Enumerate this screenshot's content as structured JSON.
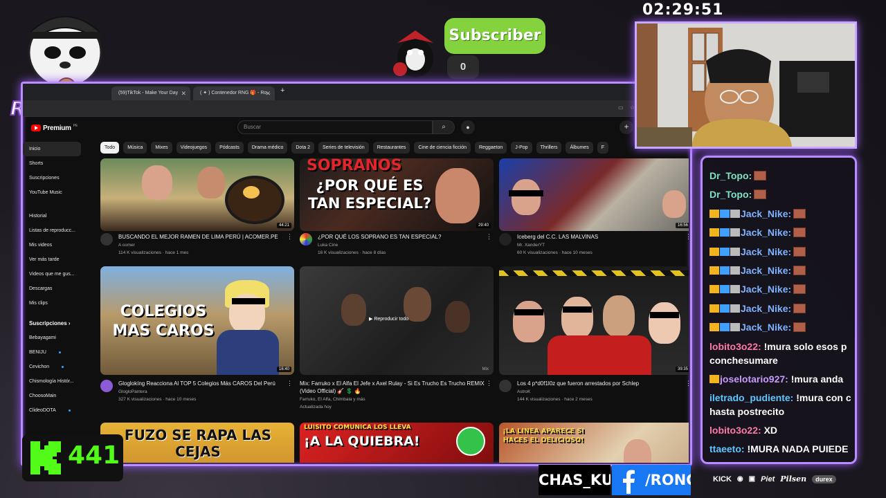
{
  "timer": "02:29:51",
  "subscriber": {
    "label": "Subscriber",
    "count": "0"
  },
  "streamer_name": "RONCHAS",
  "kick": {
    "count": "441"
  },
  "social": {
    "handle_left": "CHAS_KUN",
    "handle_right": "/RONC",
    "sponsors": [
      "KICK",
      "Piet",
      "Pilsen",
      "durex"
    ]
  },
  "browser": {
    "tabs": [
      {
        "title": "(59)TikTok - Make Your Day"
      },
      {
        "title": "( ✦ ) Contenedor RNG 🎁 - Ro..."
      }
    ]
  },
  "youtube": {
    "brand": "Premium",
    "region": "PE",
    "search_placeholder": "Buscar",
    "sidebar": {
      "main": [
        "Inicio",
        "Shorts",
        "Suscripciones",
        "YouTube Music"
      ],
      "you": [
        "Historial",
        "Listas de reproducc...",
        "Mis videos",
        "Ver más tarde",
        "Videos que me gus...",
        "Descargas",
        "Mis clips"
      ],
      "subs_header": "Suscripciones",
      "subs": [
        "Bebayagami",
        "BENIJU",
        "Cevichon",
        "Chismología Histór...",
        "ChoosoMain",
        "ClideoDOTA"
      ]
    },
    "chips": [
      "Todo",
      "Música",
      "Mixes",
      "Videojuegos",
      "Pódcasts",
      "Drama médico",
      "Dota 2",
      "Series de televisión",
      "Restaurantes",
      "Cine de ciencia ficción",
      "Reggaeton",
      "J-Pop",
      "Thrillers",
      "Álbumes",
      "F"
    ],
    "videos": [
      {
        "title": "BUSCANDO EL MEJOR RAMEN DE LIMA PERÚ | ACOMER.PE",
        "channel": "A comer",
        "stats": "114 K visualizaciones · hace 1 mes",
        "duration": "44:21",
        "thumb_text": ""
      },
      {
        "title": "¿POR QUÉ LOS SOPRANO ES TAN ESPECIAL?",
        "channel": "Luka Cine",
        "stats": "16 K visualizaciones · hace 8 días",
        "duration": "29:40",
        "thumb_text": "¿POR QUÉ ES TAN ESPECIAL?",
        "thumb_text_top": "SOPRANOS"
      },
      {
        "title": "Iceberg del C.C. LAS MALVINAS",
        "channel": "Mr. XanderYT",
        "stats": "60 K visualizaciones · hace 10 meses",
        "duration": "16:56",
        "thumb_text": ""
      },
      {
        "title": "Gloglokíng Reacciona Al TOP 5 Colegios Más CAROS Del Perú",
        "channel": "GlogloPantera",
        "stats": "327 K visualizaciones · hace 10 meses",
        "duration": "16:40",
        "thumb_text": "COLEGIOS MAS CAROS"
      },
      {
        "title": "Mix: Farruko x El Alfa El Jefe x Axel Rulay - Si Es Trucho Es Trucho REMIX (Video Official) 🎸 💲 🔥",
        "channel": "Farruko, El Alfa, Chimbala y más",
        "stats": "Actualizada hoy",
        "duration": "Mix",
        "thumb_text": "Reproducir todo"
      },
      {
        "title": "Los 4 p*d0f1l0z que fueron arrestados por Schlep",
        "channel": "AstroK",
        "stats": "144 K visualizaciones · hace 2 meses",
        "duration": "39:35",
        "thumb_text": ""
      },
      {
        "title": "",
        "channel": "",
        "stats": "",
        "duration": "",
        "thumb_text": "FUZO SE RAPA LAS CEJAS"
      },
      {
        "title": "",
        "channel": "",
        "stats": "",
        "duration": "",
        "thumb_text": "¡A LA QUIEBRA!",
        "thumb_text_top": "LUISITO COMUNICA LOS LLEVA"
      },
      {
        "title": "",
        "channel": "",
        "stats": "",
        "duration": "",
        "thumb_text": "¡LA LINEA APARECE SI HACES EL DELICIOSO!"
      }
    ]
  },
  "chat": [
    {
      "user": "Dr_Topo:",
      "msg": "",
      "color": "#7fe3c8",
      "emote": true
    },
    {
      "user": "Dr_Topo:",
      "msg": "",
      "color": "#7fe3c8",
      "emote": true
    },
    {
      "user": "Jack_Nike:",
      "msg": "",
      "color": "#7fb2ff",
      "emote": true,
      "badges": true
    },
    {
      "user": "Jack_Nike:",
      "msg": "",
      "color": "#7fb2ff",
      "emote": true,
      "badges": true
    },
    {
      "user": "Jack_Nike:",
      "msg": "",
      "color": "#7fb2ff",
      "emote": true,
      "badges": true
    },
    {
      "user": "Jack_Nike:",
      "msg": "",
      "color": "#7fb2ff",
      "emote": true,
      "badges": true
    },
    {
      "user": "Jack_Nike:",
      "msg": "",
      "color": "#7fb2ff",
      "emote": true,
      "badges": true
    },
    {
      "user": "Jack_Nike:",
      "msg": "",
      "color": "#7fb2ff",
      "emote": true,
      "badges": true
    },
    {
      "user": "Jack_Nike:",
      "msg": "",
      "color": "#7fb2ff",
      "emote": true,
      "badges": true
    },
    {
      "user": "lobito3o22:",
      "msg": "!mura solo esos p conchesumare",
      "color": "#ff7aa8"
    },
    {
      "user": "joselotario927:",
      "msg": "!mura anda",
      "color": "#c99bff",
      "badge_single": true
    },
    {
      "user": "iletrado_pudiente:",
      "msg": "!mura con c hasta postrecito",
      "color": "#5ec7ff"
    },
    {
      "user": "lobito3o22:",
      "msg": "XD",
      "color": "#ff7aa8"
    },
    {
      "user": "ttaeeto:",
      "msg": "!MURA NADA PUIEDE",
      "color": "#5ec7ff"
    }
  ]
}
